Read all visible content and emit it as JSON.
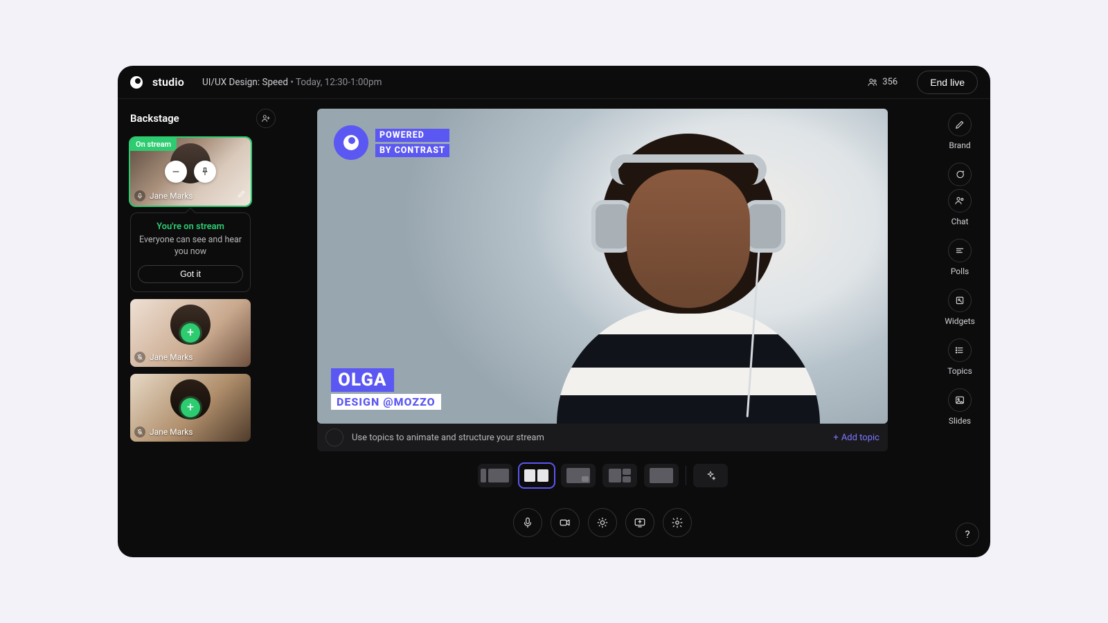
{
  "header": {
    "brand": "studio",
    "session_title": "UI/UX Design: Speed",
    "session_time": "Today, 12:30-1:00pm",
    "viewers": "356",
    "end_live": "End live"
  },
  "backstage": {
    "title": "Backstage",
    "tiles": [
      {
        "name": "Jane Marks",
        "badge": "On stream",
        "on_stream": true
      },
      {
        "name": "Jane Marks",
        "on_stream": false
      },
      {
        "name": "Jane Marks",
        "on_stream": false
      }
    ],
    "popover": {
      "headline": "You're on stream",
      "sub": "Everyone can see and hear you now",
      "cta": "Got it"
    }
  },
  "stage": {
    "watermark_line1": "POWERED",
    "watermark_line2": "BY CONTRAST",
    "lower_third_name": "OLGA",
    "lower_third_sub": "DESIGN @MOZZO"
  },
  "topic_bar": {
    "hint": "Use topics to animate and structure your stream",
    "add": "Add topic"
  },
  "rail": {
    "brand": "Brand",
    "chat": "Chat",
    "polls": "Polls",
    "widgets": "Widgets",
    "topics": "Topics",
    "slides": "Slides"
  },
  "help": "?"
}
